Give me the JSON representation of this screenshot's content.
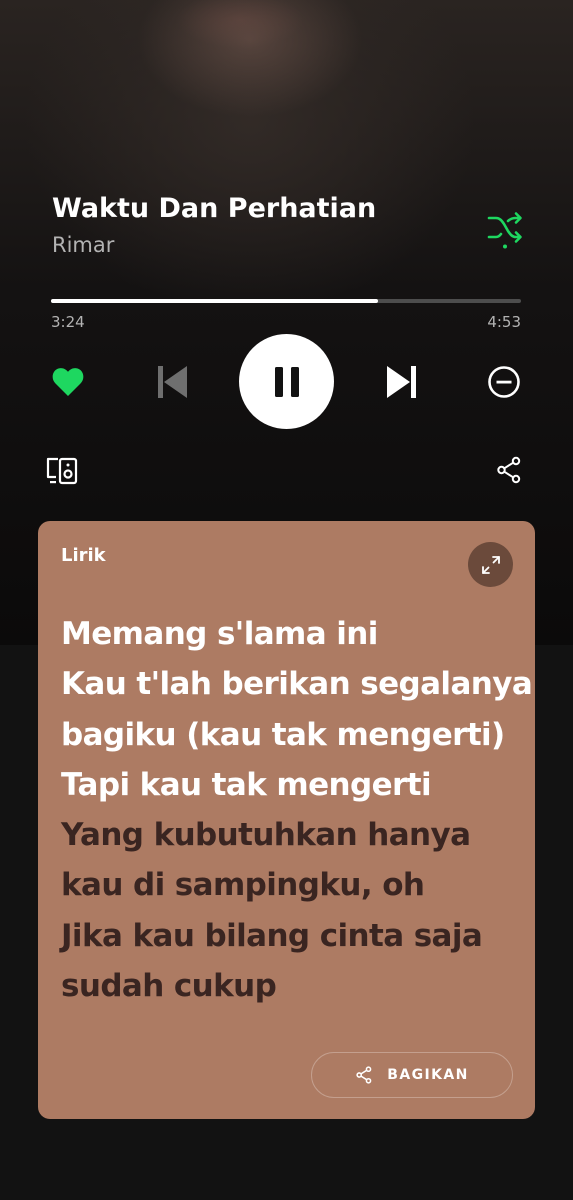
{
  "now_playing": {
    "title": "Waktu Dan Perhatian",
    "artist": "Rimar",
    "elapsed": "3:24",
    "duration": "4:53",
    "progress_fraction": 0.696,
    "is_liked": true,
    "is_playing": true,
    "shuffle_enabled": true
  },
  "icons": {
    "shuffle": "shuffle-icon",
    "like": "heart-filled-icon",
    "previous": "skip-previous-icon",
    "play_pause": "pause-icon",
    "next": "skip-next-icon",
    "remove": "minus-circle-icon",
    "devices": "connect-devices-icon",
    "share": "share-icon",
    "expand": "expand-icon"
  },
  "lyrics": {
    "label": "Lirik",
    "lines": [
      {
        "text": "Memang s'lama ini",
        "state": "past"
      },
      {
        "text": "Kau t'lah berikan segalanya",
        "state": "past"
      },
      {
        "text": "bagiku (kau tak mengerti)",
        "state": "past"
      },
      {
        "text": "Tapi kau tak mengerti",
        "state": "past"
      },
      {
        "text": "Yang kubutuhkan hanya",
        "state": "upcoming"
      },
      {
        "text": "kau di sampingku, oh",
        "state": "upcoming"
      },
      {
        "text": "Jika kau bilang cinta saja",
        "state": "upcoming"
      },
      {
        "text": "sudah cukup",
        "state": "upcoming"
      }
    ],
    "share_label": "BAGIKAN"
  },
  "colors": {
    "accent_green": "#1ed760",
    "lyrics_card": "#ad7b63",
    "lyrics_upcoming_text": "#3a2521",
    "background": "#121212"
  }
}
